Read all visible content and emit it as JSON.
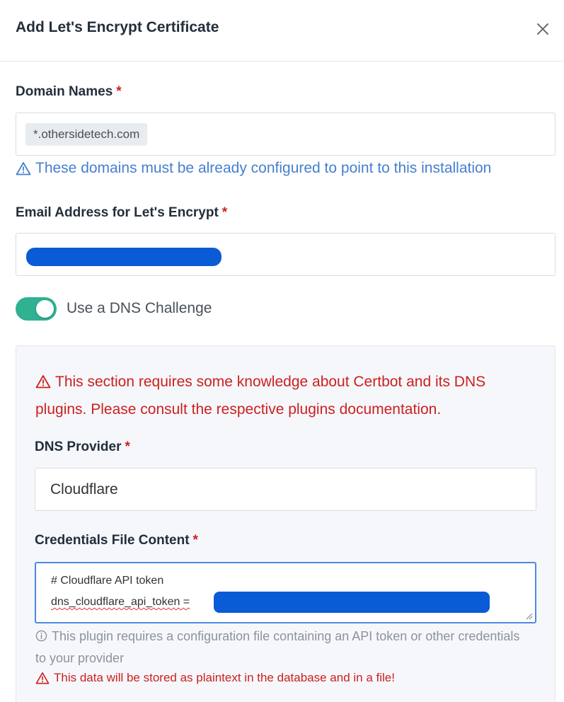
{
  "modal": {
    "title": "Add Let's Encrypt Certificate",
    "close_icon": "close-icon"
  },
  "domain_names": {
    "label": "Domain Names",
    "required_mark": "*",
    "tag": "*.othersidetech.com",
    "hint": "These domains must be already configured to point to this installation",
    "hint_icon": "warning-triangle-icon"
  },
  "email": {
    "label": "Email Address for Let's Encrypt",
    "required_mark": "*",
    "value_redacted": true
  },
  "dns_challenge": {
    "toggle_on": true,
    "label": "Use a DNS Challenge",
    "accent_color": "#2fb192"
  },
  "dns_section": {
    "warning": "This section requires some knowledge about Certbot and its DNS plugins. Please consult the respective plugins documentation.",
    "provider_label": "DNS Provider",
    "provider_required_mark": "*",
    "provider_value": "Cloudflare",
    "credentials_label": "Credentials File Content",
    "credentials_required_mark": "*",
    "credentials_line1": "# Cloudflare API token",
    "credentials_line2": "dns_cloudflare_api_token =",
    "info": "This plugin requires a configuration file containing an API token or other credentials to your provider",
    "plaintext_warning": "This data will be stored as plaintext in the database and in a file!"
  },
  "colors": {
    "danger": "#cd201f",
    "link": "#467fcf",
    "redaction": "#0a5bd6",
    "focus_border": "#4d8ae0"
  }
}
